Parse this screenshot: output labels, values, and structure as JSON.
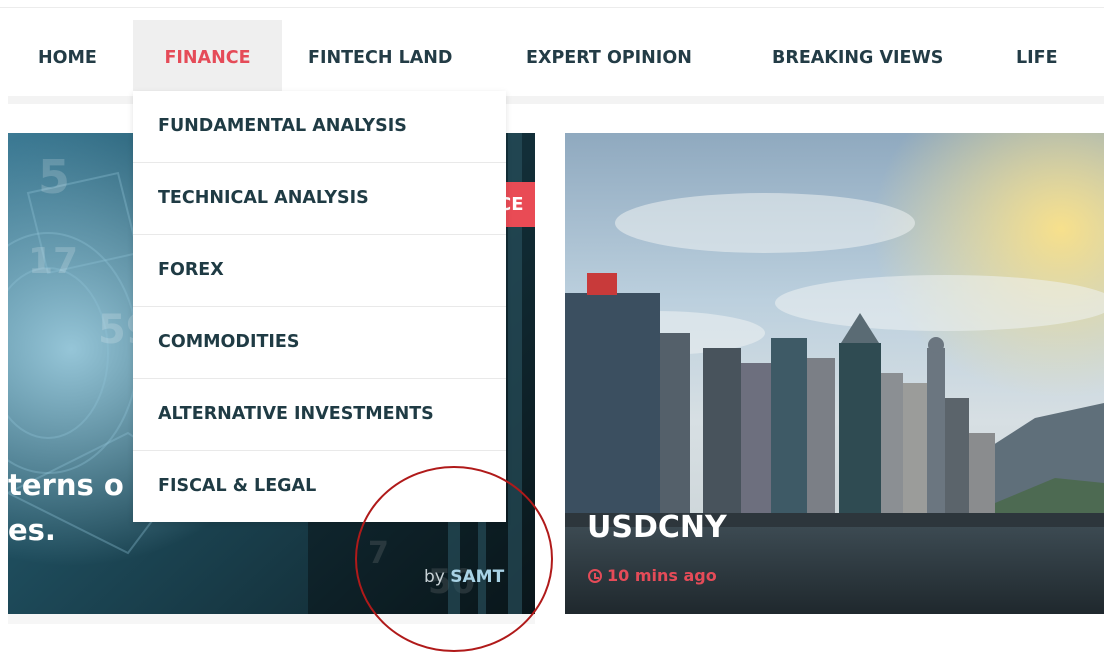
{
  "nav": {
    "items": [
      {
        "label": "HOME"
      },
      {
        "label": "FINANCE",
        "active": true
      },
      {
        "label": "FINTECH LAND"
      },
      {
        "label": "EXPERT OPINION"
      },
      {
        "label": "BREAKING VIEWS"
      },
      {
        "label": "LIFE"
      }
    ],
    "active_color": "#e54b58",
    "text_color": "#233c46"
  },
  "dropdown": {
    "items": [
      {
        "label": "FUNDAMENTAL ANALYSIS"
      },
      {
        "label": "TECHNICAL ANALYSIS"
      },
      {
        "label": "FOREX"
      },
      {
        "label": "COMMODITIES"
      },
      {
        "label": "ALTERNATIVE INVESTMENTS"
      },
      {
        "label": "FISCAL & LEGAL"
      }
    ]
  },
  "left_card": {
    "badge": "CE",
    "title_line1": "terns o",
    "title_line2": "es.",
    "by_prefix": "by",
    "author": "SAMT"
  },
  "right_card": {
    "title": "USDCNY",
    "time": "10 mins ago",
    "clock_icon": "clock-icon"
  },
  "annotation": {
    "color": "#b01a1a"
  }
}
